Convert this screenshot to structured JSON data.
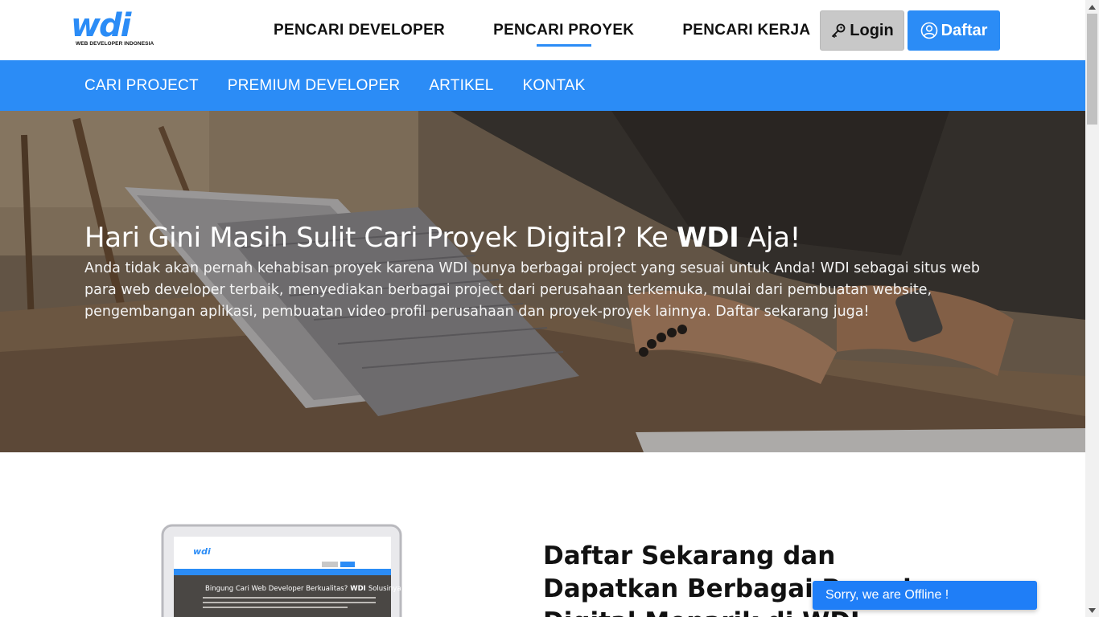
{
  "logo": {
    "mark": "wdi",
    "subtitle": "WEB DEVELOPER INDONESIA"
  },
  "main_nav": {
    "items": [
      {
        "label": "PENCARI DEVELOPER",
        "active": false
      },
      {
        "label": "PENCARI PROYEK",
        "active": true
      },
      {
        "label": "PENCARI KERJA",
        "active": false
      }
    ]
  },
  "auth": {
    "login_label": "Login",
    "register_label": "Daftar"
  },
  "sub_nav": {
    "items": [
      {
        "label": "CARI PROJECT"
      },
      {
        "label": "PREMIUM DEVELOPER"
      },
      {
        "label": "ARTIKEL"
      },
      {
        "label": "KONTAK"
      }
    ]
  },
  "hero": {
    "title_before": "Hari Gini Masih Sulit Cari Proyek Digital? Ke ",
    "title_brand": "WDI",
    "title_after": " Aja!",
    "description": "Anda tidak akan pernah kehabisan proyek karena WDI punya berbagai project yang sesuai untuk Anda! WDI sebagai situs web para web developer terbaik, menyediakan berbagai project dari perusahaan terkemuka, mulai dari pembuatan website, pengembangan aplikasi, pembuatan video profil perusahaan dan proyek-proyek lainnya. Daftar sekarang juga!"
  },
  "section": {
    "title": "Daftar Sekarang dan Dapatkan Berbagai Proyek Digital Menarik di WDI"
  },
  "laptop_preview": {
    "logo": "wdi",
    "headline": "Bingung Cari Web Developer Berkualitas?",
    "brand": "WDI",
    "headline_tail": "Solusinya"
  },
  "chat": {
    "status_text": "Sorry, we are Offline !"
  },
  "colors": {
    "brand_blue": "#2b8cf6",
    "login_gray": "#c8c8c8",
    "chat_blue": "#1f7ef7"
  },
  "icons": {
    "login": "key-icon",
    "register": "user-circle-icon"
  }
}
